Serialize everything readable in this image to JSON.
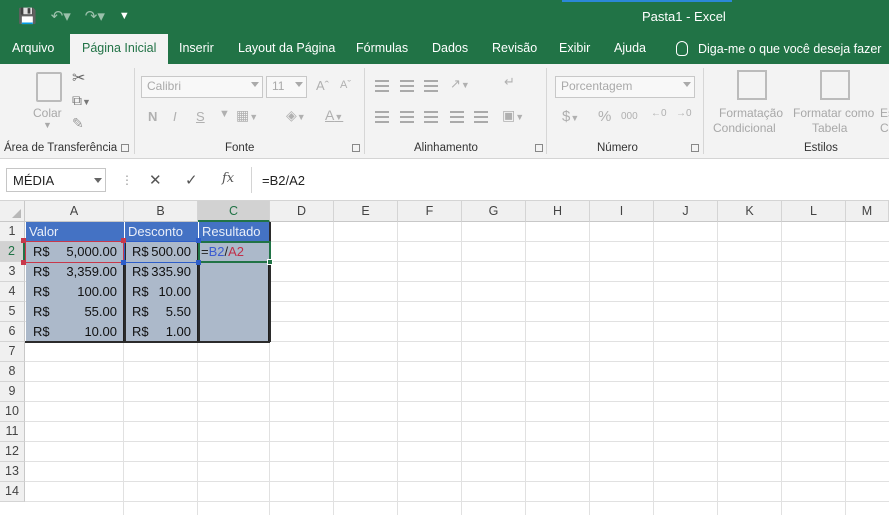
{
  "window": {
    "title": "Pasta1  -  Excel",
    "qat": {
      "save_icon": "save-icon",
      "undo_icon": "undo-icon",
      "redo_icon": "redo-icon",
      "customize_icon": "customize-qat-icon"
    }
  },
  "tabs": [
    "Arquivo",
    "Página Inicial",
    "Inserir",
    "Layout da Página",
    "Fórmulas",
    "Dados",
    "Revisão",
    "Exibir",
    "Ajuda"
  ],
  "tell_me": "Diga-me o que você deseja fazer",
  "ribbon": {
    "clipboard": {
      "label": "Área de Transferência",
      "paste": "Colar"
    },
    "font": {
      "label": "Fonte",
      "font_name": "Calibri",
      "font_size": "11",
      "bold": "N",
      "italic": "I",
      "underline": "S"
    },
    "alignment": {
      "label": "Alinhamento"
    },
    "number": {
      "label": "Número",
      "format": "Porcentagem",
      "currency": "$",
      "percent": "%",
      "thousands": "000"
    },
    "styles": {
      "label": "Estilos",
      "cond_fmt_1": "Formatação",
      "cond_fmt_2": "Condicional",
      "fmt_table_1": "Formatar como",
      "fmt_table_2": "Tabela",
      "cell_styles_cut": "Es",
      "cell_styles_cut2": "C"
    }
  },
  "formula_bar": {
    "name_box": "MÉDIA",
    "cancel": "✕",
    "enter": "✓",
    "fx": "fx",
    "formula": "=B2/A2"
  },
  "columns": [
    "A",
    "B",
    "C",
    "D",
    "E",
    "F",
    "G",
    "H",
    "I",
    "J",
    "K",
    "L",
    "M"
  ],
  "rows": [
    "1",
    "2",
    "3",
    "4",
    "5",
    "6",
    "7",
    "8",
    "9",
    "10",
    "11",
    "12",
    "13",
    "14"
  ],
  "table": {
    "headers": [
      "Valor",
      "Desconto",
      "Resultado"
    ],
    "currency_symbol": "R$",
    "valor": [
      "5,000.00",
      "3,359.00",
      "100.00",
      "55.00",
      "10.00"
    ],
    "desconto": [
      "500.00",
      "335.90",
      "10.00",
      "5.50",
      "1.00"
    ],
    "editing": {
      "eq": "=",
      "ref_b": "B2",
      "slash": "/",
      "ref_a": "A2"
    }
  },
  "colors": {
    "excel_green": "#217346",
    "header_fill": "#4472c4",
    "data_fill": "#acb9ca",
    "ref_blue": "#3b5bd1",
    "ref_red": "#c0304a"
  }
}
